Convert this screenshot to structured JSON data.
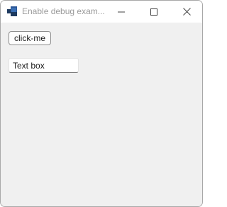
{
  "window": {
    "title": "Enable debug exam...",
    "icon": "app-window-icon",
    "controls": {
      "minimize": "minimize-icon",
      "maximize": "maximize-icon",
      "close": "close-icon"
    }
  },
  "content": {
    "button_label": "click-me",
    "textbox_value": "Text box"
  },
  "colors": {
    "titlebar_bg": "#ffffff",
    "client_bg": "#f0f0f0",
    "title_text": "#9a9a9a",
    "icon_blue": "#2b5797",
    "icon_dark": "#1e3a5f"
  }
}
